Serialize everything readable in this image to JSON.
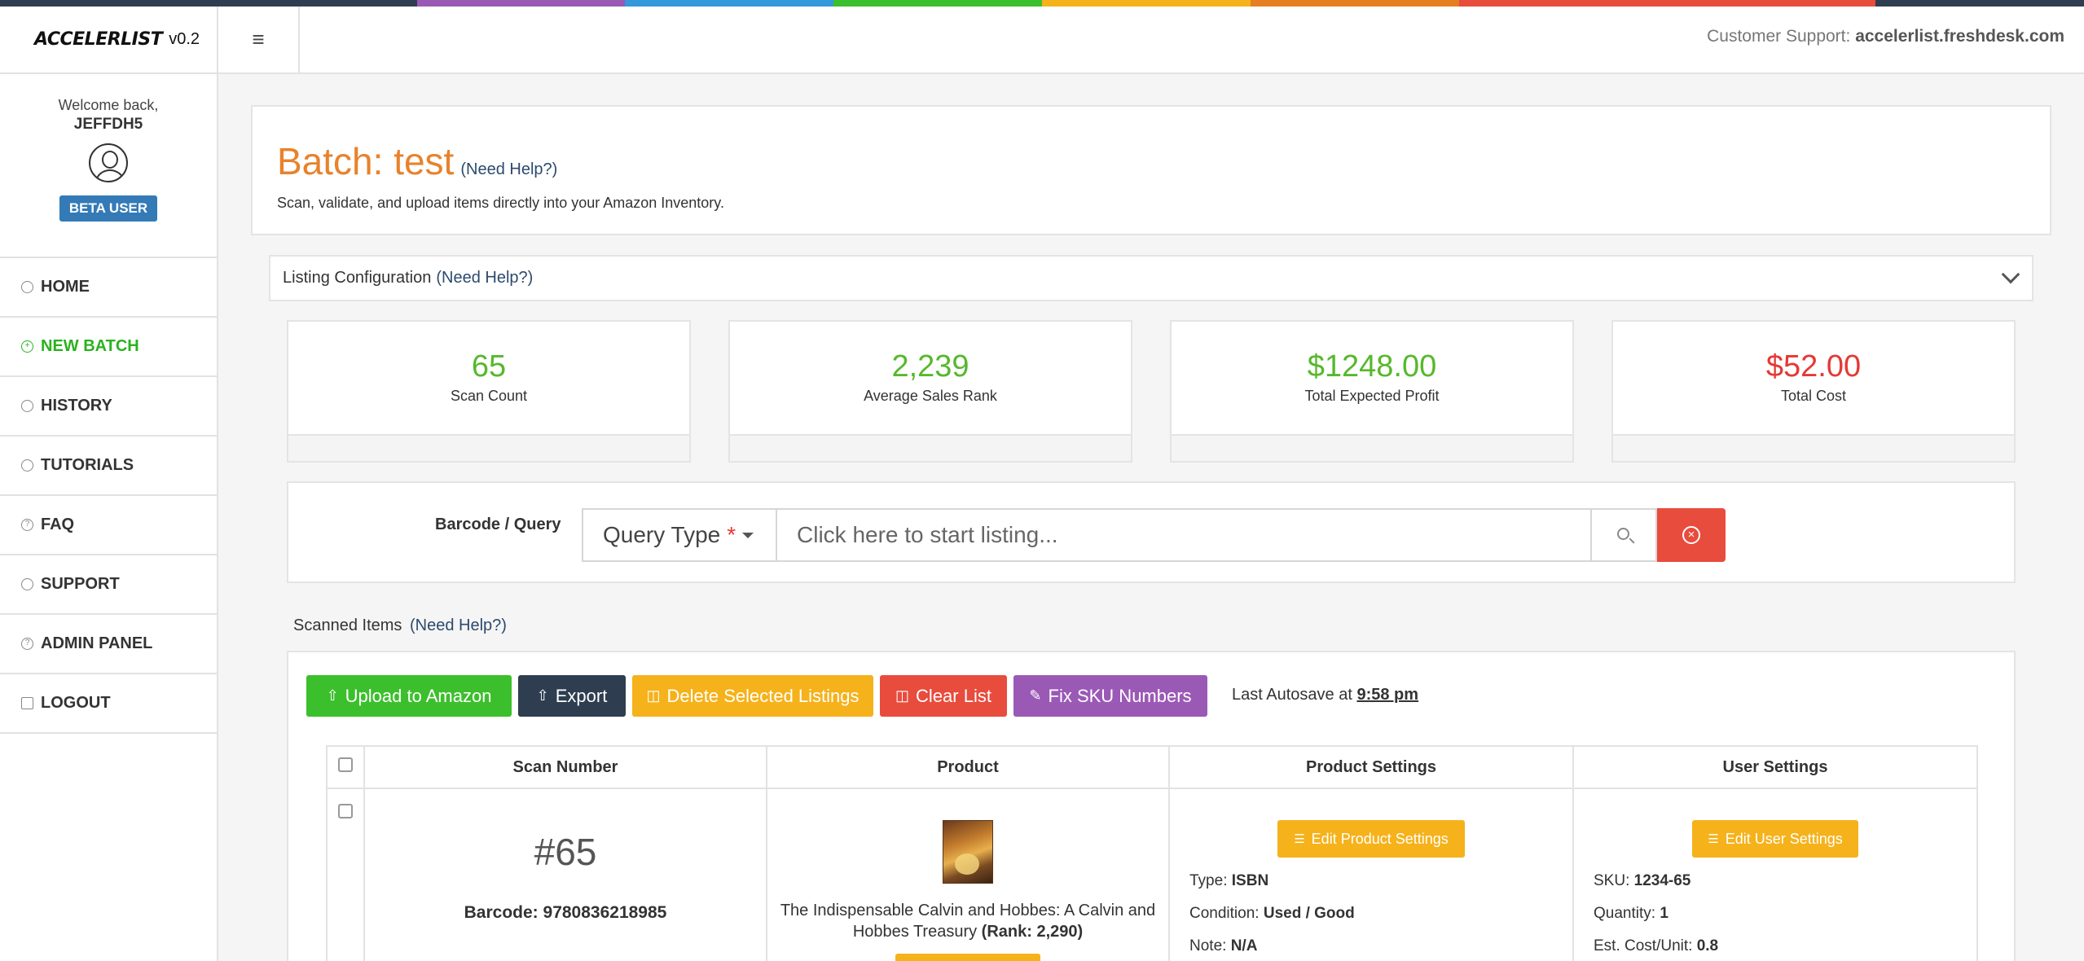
{
  "colors": {
    "strip": [
      "#2e3e50",
      "#2e3e50",
      "#9b59b6",
      "#3498db",
      "#3cbf2c",
      "#f5b21b",
      "#e67e22",
      "#e84c3d",
      "#e84c3d",
      "#2e3e50"
    ],
    "accent_green": "#57b82d",
    "accent_orange": "#e8822c",
    "danger_red": "#e53935"
  },
  "brand": {
    "logo_text": "ACCELERLIST",
    "version": "v0.2"
  },
  "profile": {
    "welcome": "Welcome back,",
    "username": "JEFFDH5",
    "badge": "BETA USER"
  },
  "nav": {
    "items": [
      {
        "label": "HOME",
        "icon": "home-icon"
      },
      {
        "label": "NEW BATCH",
        "icon": "plus-circle-icon"
      },
      {
        "label": "HISTORY",
        "icon": "clock-icon"
      },
      {
        "label": "TUTORIALS",
        "icon": "book-icon"
      },
      {
        "label": "FAQ",
        "icon": "question-icon"
      },
      {
        "label": "SUPPORT",
        "icon": "lifebuoy-icon"
      },
      {
        "label": "ADMIN PANEL",
        "icon": "question-icon"
      },
      {
        "label": "LOGOUT",
        "icon": "sign-out-icon"
      }
    ]
  },
  "header": {
    "menu_icon": "hamburger-icon",
    "support_label": "Customer Support:",
    "support_link": "accelerlist.freshdesk.com"
  },
  "batch": {
    "title": "Batch: test",
    "help": "(Need Help?)",
    "subtitle": "Scan, validate, and upload items directly into your Amazon Inventory."
  },
  "config": {
    "title": "Listing Configuration",
    "help": "(Need Help?)"
  },
  "stats": [
    {
      "value": "65",
      "label": "Scan Count"
    },
    {
      "value": "2,239",
      "label": "Average Sales Rank"
    },
    {
      "value": "$1248.00",
      "label": "Total Expected Profit"
    },
    {
      "value": "$52.00",
      "label": "Total Cost"
    }
  ],
  "query": {
    "label": "Barcode / Query",
    "type_label": "Query Type",
    "required_mark": "*",
    "placeholder": "Click here to start listing..."
  },
  "scanned": {
    "title": "Scanned Items",
    "help": "(Need Help?)",
    "buttons": {
      "upload": "Upload to Amazon",
      "export": "Export",
      "delete": "Delete Selected Listings",
      "clear": "Clear List",
      "fix_sku": "Fix SKU Numbers"
    },
    "autosave_label": "Last Autosave at",
    "autosave_time": "9:58 pm"
  },
  "table": {
    "headers": [
      "Scan Number",
      "Product",
      "Product Settings",
      "User Settings"
    ],
    "row": {
      "scan_number": "#65",
      "barcode_label": "Barcode:",
      "barcode": "9780836218985",
      "product_title": "The Indispensable Calvin and Hobbes: A Calvin and Hobbes Treasury",
      "rank": "(Rank: 2,290)",
      "edit_product_btn": "Edit Product Settings",
      "type_label": "Type:",
      "type_value": "ISBN",
      "condition_label": "Condition:",
      "condition_value": "Used / Good",
      "note_label": "Note:",
      "note_value": "N/A",
      "edit_user_btn": "Edit User Settings",
      "sku_label": "SKU:",
      "sku_value": "1234-65",
      "qty_label": "Quantity:",
      "qty_value": "1",
      "cost_label": "Est. Cost/Unit:",
      "cost_value": "0.8"
    }
  }
}
